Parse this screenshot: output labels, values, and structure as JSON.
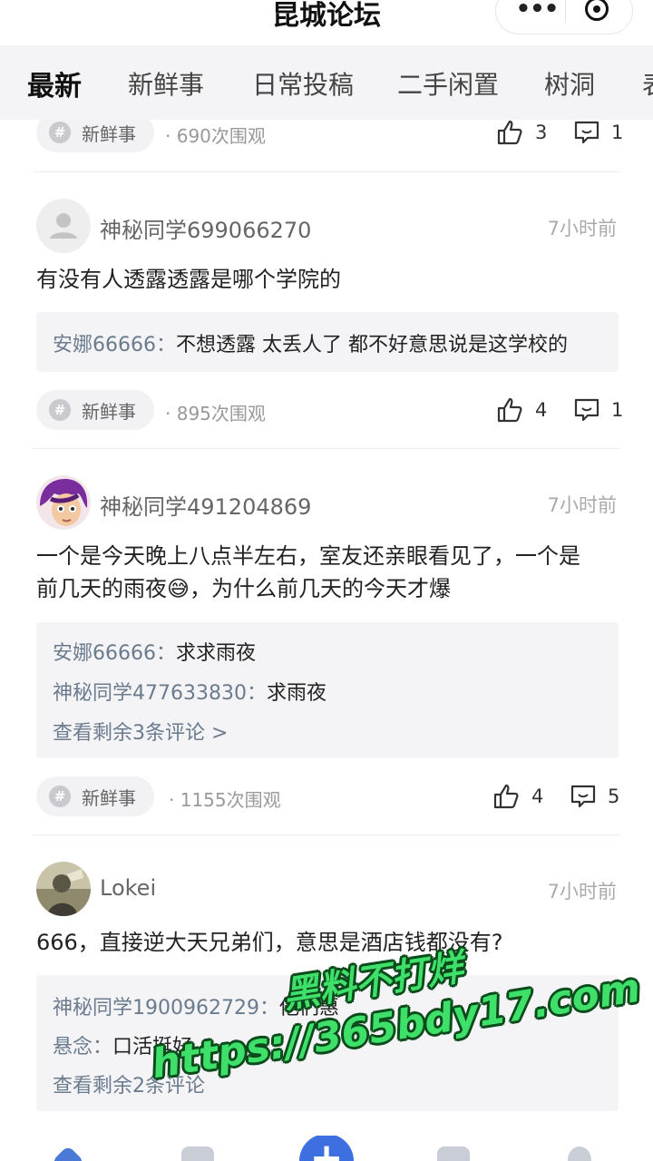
{
  "app": {
    "title": "昆城论坛"
  },
  "tabs": [
    {
      "label": "最新",
      "active": true
    },
    {
      "label": "新鲜事",
      "active": false
    },
    {
      "label": "日常投稿",
      "active": false
    },
    {
      "label": "二手闲置",
      "active": false
    },
    {
      "label": "树洞",
      "active": false
    },
    {
      "label": "表",
      "active": false
    }
  ],
  "posts": [
    {
      "tag": "新鲜事",
      "views": "· 690次围观",
      "likes": "3",
      "comments": "1"
    },
    {
      "user": "神秘同学699066270",
      "time": "7小时前",
      "text": "有没有人透露透露是哪个学院的",
      "replies": [
        {
          "user": "安娜66666：",
          "text": "不想透露 太丢人了 都不好意思说是这学校的"
        }
      ],
      "tag": "新鲜事",
      "views": "· 895次围观",
      "likes": "4",
      "comments": "1"
    },
    {
      "user": "神秘同学491204869",
      "time": "7小时前",
      "text_line1": "一个是今天晚上八点半左右，室友还亲眼看见了，一个是",
      "text_line2": "前几天的雨夜😅，为什么前几天的今天才爆",
      "replies": [
        {
          "user": "安娜66666：",
          "text": "求求雨夜"
        },
        {
          "user": "神秘同学477633830：",
          "text": "求雨夜"
        }
      ],
      "more_replies": "查看剩余3条评论 >",
      "tag": "新鲜事",
      "views": "· 1155次围观",
      "likes": "4",
      "comments": "5"
    },
    {
      "user": "Lokei",
      "time": "7小时前",
      "text": "666，直接逆大天兄弟们，意思是酒店钱都没有?",
      "replies": [
        {
          "user": "神秘同学1900962729：",
          "text": "他们惠"
        },
        {
          "user": "悬念：",
          "text": "口活挺好"
        }
      ],
      "more_replies": "查看剩余2条评论"
    }
  ],
  "watermark": {
    "line1": "黑料不打烊",
    "line2": "https://365bdy17.com"
  },
  "colors": {
    "accent": "#3d6fe0",
    "comment_user": "#6b7b8e",
    "watermark": "#3ee06a"
  }
}
